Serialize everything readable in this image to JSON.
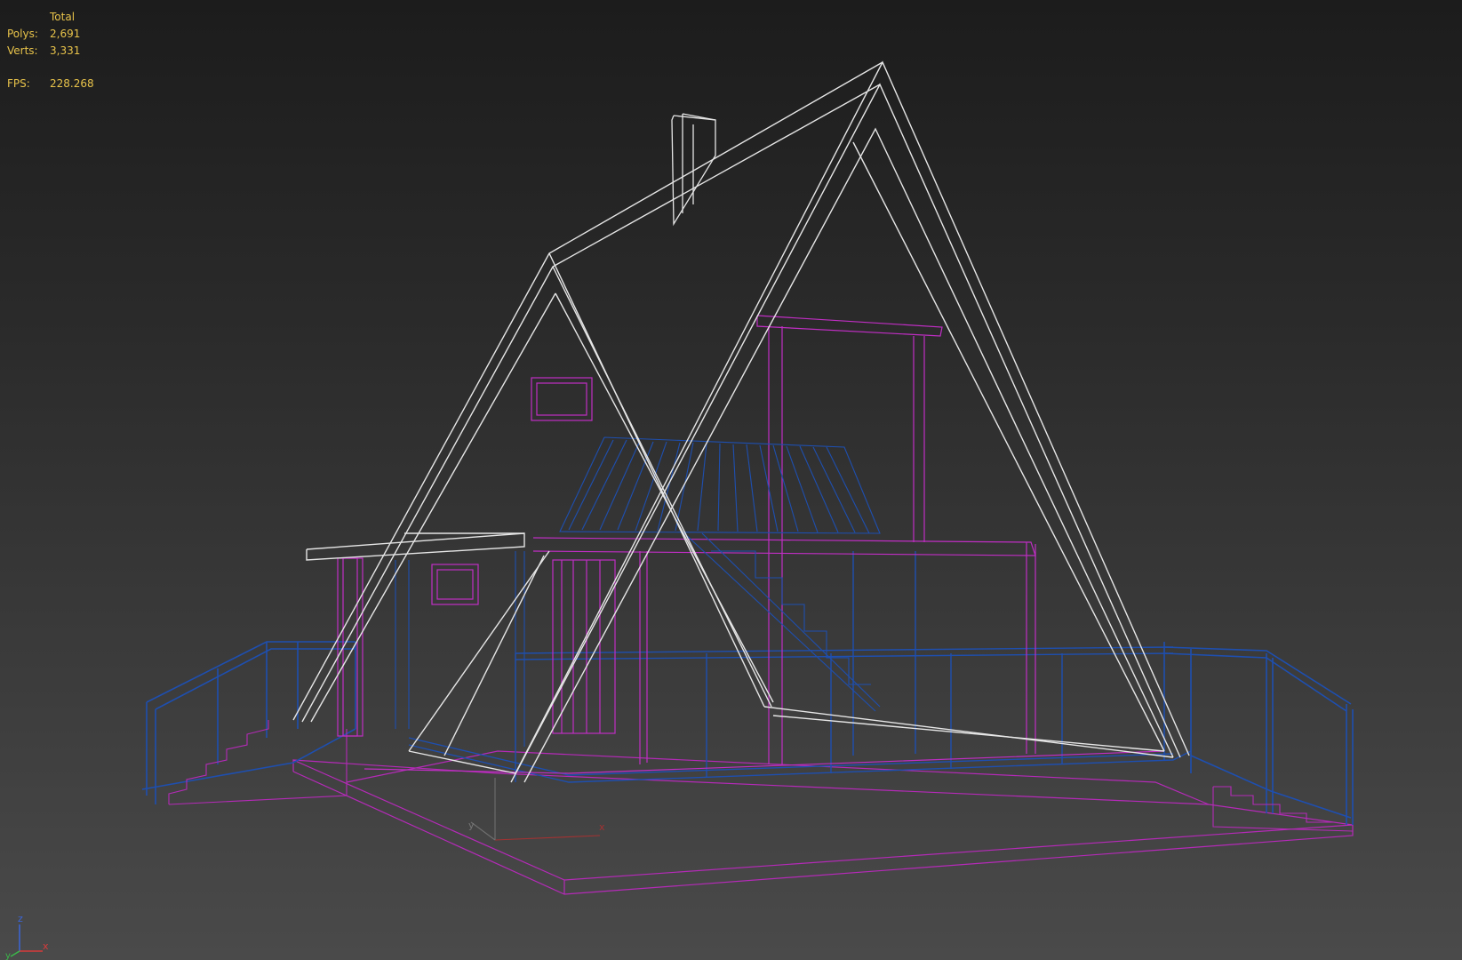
{
  "stats": {
    "header": "Total",
    "polys_label": "Polys:",
    "polys_value": "2,691",
    "verts_label": "Verts:",
    "verts_value": "3,331",
    "fps_label": "FPS:",
    "fps_value": "228.268"
  },
  "axis_gizmo": {
    "z": "z",
    "x": "x",
    "y": "y"
  },
  "grid_gizmo": {
    "x": "x",
    "y": "y"
  },
  "colors": {
    "roof": "#e6e6e6",
    "frame_magenta": "#c02ec4",
    "rail_blue": "#1e4fb0",
    "stats_text": "#e8c34a",
    "axis_z": "#3b66d8",
    "axis_x": "#d83b3b",
    "axis_y": "#3bb84a"
  }
}
